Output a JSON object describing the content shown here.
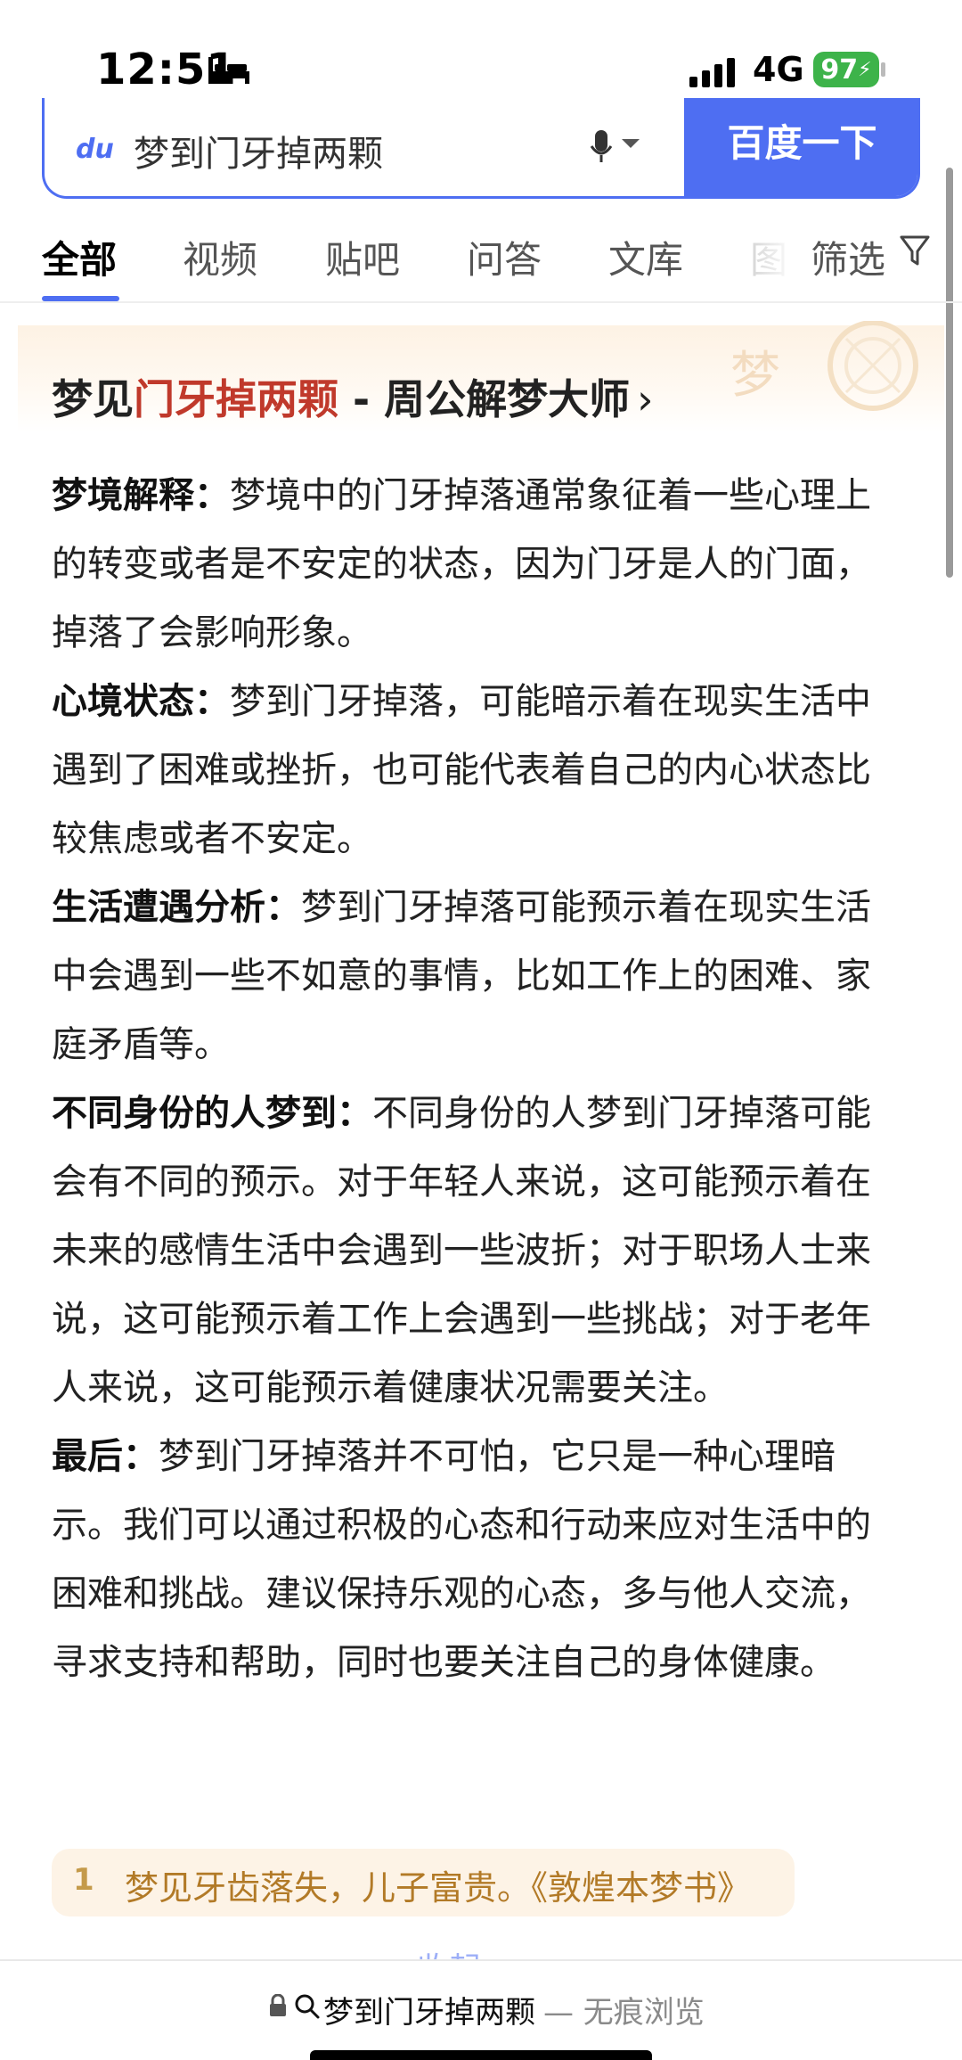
{
  "status_bar": {
    "time": "12:51",
    "network": "4G",
    "battery": "97"
  },
  "search": {
    "logo": "du",
    "query": "梦到门牙掉两颗",
    "button_label": "百度一下"
  },
  "tabs": [
    {
      "label": "全部",
      "active": true
    },
    {
      "label": "视频",
      "active": false
    },
    {
      "label": "贴吧",
      "active": false
    },
    {
      "label": "问答",
      "active": false
    },
    {
      "label": "文库",
      "active": false
    },
    {
      "label": "图",
      "active": false
    }
  ],
  "filter_label": "筛选",
  "result": {
    "title_prefix": "梦见",
    "title_highlight": "门牙掉两颗",
    "title_suffix": " - 周公解梦大师",
    "title_chevron": "›",
    "paragraphs": [
      {
        "label": "梦境解释：",
        "text": "梦境中的门牙掉落通常象征着一些心理上的转变或者是不安定的状态，因为门牙是人的门面，掉落了会影响形象。"
      },
      {
        "label": "心境状态：",
        "text": "梦到门牙掉落，可能暗示着在现实生活中遇到了困难或挫折，也可能代表着自己的内心状态比较焦虑或者不安定。"
      },
      {
        "label": "生活遭遇分析：",
        "text": "梦到门牙掉落可能预示着在现实生活中会遇到一些不如意的事情，比如工作上的困难、家庭矛盾等。"
      },
      {
        "label": "不同身份的人梦到：",
        "text": "不同身份的人梦到门牙掉落可能会有不同的预示。对于年轻人来说，这可能预示着在未来的感情生活中会遇到一些波折；对于职场人士来说，这可能预示着工作上会遇到一些挑战；对于老年人来说，这可能预示着健康状况需要关注。"
      },
      {
        "label": "最后：",
        "text": "梦到门牙掉落并不可怕，它只是一种心理暗示。我们可以通过积极的心态和行动来应对生活中的困难和挑战。建议保持乐观的心态，多与他人交流，寻求支持和帮助，同时也要关注自己的身体健康。"
      }
    ],
    "quote_number": "1",
    "quote_text": "梦见牙齿落失，儿子富贵。《敦煌本梦书》",
    "collapse_label": "收起"
  },
  "bottom_bar": {
    "query": "梦到门牙掉两颗",
    "mode": "— 无痕浏览"
  },
  "colors": {
    "accent": "#4e6ef2",
    "highlight": "#c0392b",
    "quote": "#b27a27",
    "battery": "#3db34a"
  }
}
